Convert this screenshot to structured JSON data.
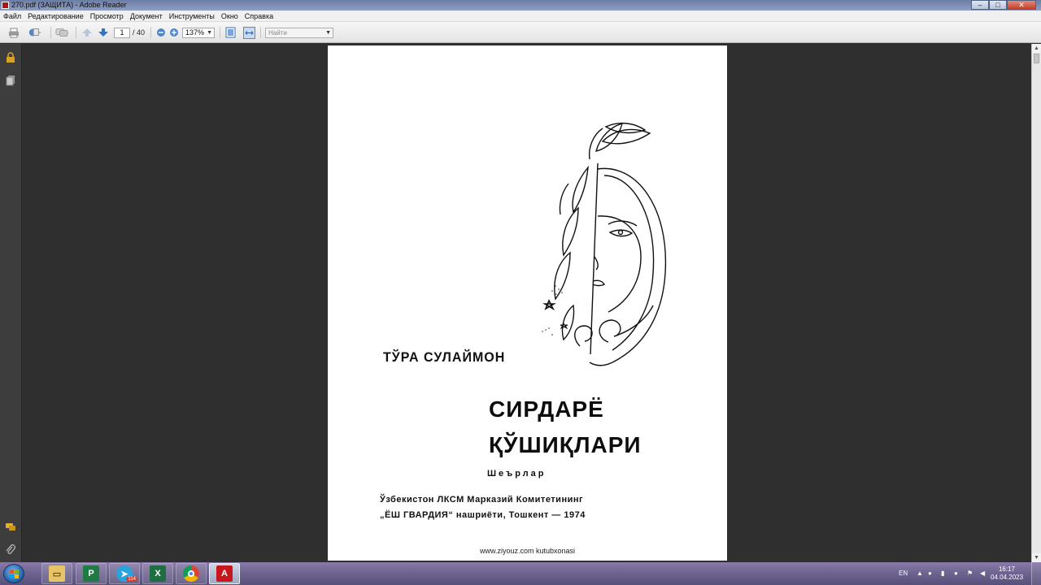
{
  "window": {
    "title": "270.pdf (ЗАЩИТА) - Adobe Reader",
    "minimize": "–",
    "maximize": "□",
    "close": "✕"
  },
  "menu": [
    "Файл",
    "Редактирование",
    "Просмотр",
    "Документ",
    "Инструменты",
    "Окно",
    "Справка"
  ],
  "toolbar": {
    "page_current": "1",
    "page_total": "/ 40",
    "zoom": "137%",
    "find_placeholder": "Найти",
    "icons": [
      "print-icon",
      "email-icon",
      "comment-icon",
      "prev-page-icon",
      "next-page-icon",
      "zoom-out-icon",
      "zoom-in-icon",
      "fit-page-icon",
      "fit-width-icon"
    ]
  },
  "document": {
    "author": "ТЎРА СУЛАЙМОН",
    "title_line1": "СИРДАРЁ",
    "title_line2": "ҚЎШИҚЛАРИ",
    "subtitle": "Шеърлар",
    "publisher_line1": "Ўзбекистон ЛКСМ Марказий Комитетининг",
    "publisher_line2": "„ЁШ ГВАРДИЯ“ нашриёти, Тошкент — 1974",
    "footer": "www.ziyouz.com kutubxonasi"
  },
  "taskbar": {
    "apps": [
      "explorer",
      "project",
      "telegram",
      "excel",
      "chrome",
      "adobe-reader"
    ],
    "telegram_badge": "114",
    "language": "EN",
    "time": "16:17",
    "date": "04.04.2023"
  },
  "colors": {
    "doc_background": "#2f2f2f",
    "page": "#ffffff",
    "taskbar": "#6f6590"
  }
}
